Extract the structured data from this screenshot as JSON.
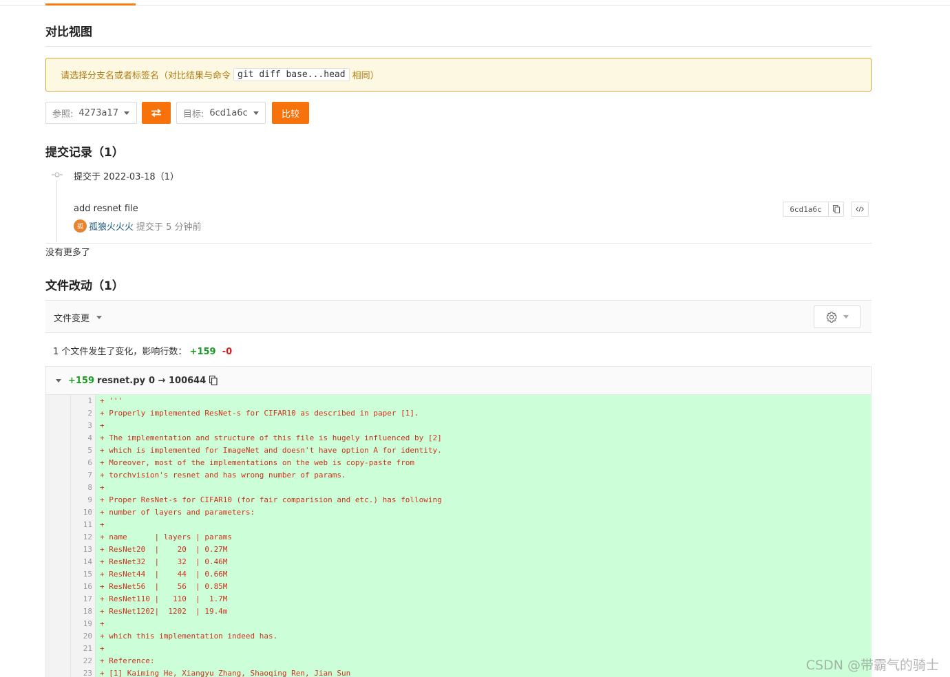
{
  "page": {
    "title": "对比视图"
  },
  "notice": {
    "text_before": "请选择分支名或者标签名（对比结果与命令",
    "command": "git diff base...head",
    "text_after": "相同）"
  },
  "compare": {
    "base_label": "参照:",
    "base_value": "4273a17",
    "swap_icon": "swap-arrows-icon",
    "target_label": "目标:",
    "target_value": "6cd1a6c",
    "compare_button": "比较"
  },
  "commits": {
    "heading": "提交记录（1）",
    "group_label": "提交于 2022-03-18（1）",
    "items": [
      {
        "message": "add resnet file",
        "avatar_char": "孤",
        "author": "孤狼火火火",
        "time_text": "提交于 5 分钟前",
        "sha": "6cd1a6c"
      }
    ],
    "no_more": "没有更多了"
  },
  "files": {
    "heading": "文件改动（1）",
    "filter_label": "文件变更",
    "summary_text": "1 个文件发生了变化，影响行数：",
    "additions": "+159",
    "deletions": "-0"
  },
  "diff": {
    "added": "+159",
    "filename": "resnet.py",
    "mode_change": "0 → 100644",
    "lines": [
      {
        "n": "1",
        "text": "+ '''"
      },
      {
        "n": "2",
        "text": "+ Properly implemented ResNet-s for CIFAR10 as described in paper [1]."
      },
      {
        "n": "3",
        "text": "+"
      },
      {
        "n": "4",
        "text": "+ The implementation and structure of this file is hugely influenced by [2]"
      },
      {
        "n": "5",
        "text": "+ which is implemented for ImageNet and doesn't have option A for identity."
      },
      {
        "n": "6",
        "text": "+ Moreover, most of the implementations on the web is copy-paste from"
      },
      {
        "n": "7",
        "text": "+ torchvision's resnet and has wrong number of params."
      },
      {
        "n": "8",
        "text": "+"
      },
      {
        "n": "9",
        "text": "+ Proper ResNet-s for CIFAR10 (for fair comparision and etc.) has following"
      },
      {
        "n": "10",
        "text": "+ number of layers and parameters:"
      },
      {
        "n": "11",
        "text": "+"
      },
      {
        "n": "12",
        "text": "+ name      | layers | params"
      },
      {
        "n": "13",
        "text": "+ ResNet20  |    20  | 0.27M"
      },
      {
        "n": "14",
        "text": "+ ResNet32  |    32  | 0.46M"
      },
      {
        "n": "15",
        "text": "+ ResNet44  |    44  | 0.66M"
      },
      {
        "n": "16",
        "text": "+ ResNet56  |    56  | 0.85M"
      },
      {
        "n": "17",
        "text": "+ ResNet110 |   110  |  1.7M"
      },
      {
        "n": "18",
        "text": "+ ResNet1202|  1202  | 19.4m"
      },
      {
        "n": "19",
        "text": "+"
      },
      {
        "n": "20",
        "text": "+ which this implementation indeed has."
      },
      {
        "n": "21",
        "text": "+"
      },
      {
        "n": "22",
        "text": "+ Reference:"
      },
      {
        "n": "23",
        "text": "+ [1] Kaiming He, Xiangyu Zhang, Shaoqing Ren, Jian Sun"
      }
    ]
  },
  "watermark": "CSDN @带霸气的骑士",
  "colors": {
    "accent": "#f8720c",
    "added_bg": "#ccffd8",
    "added_text": "#c8321e",
    "plus": "#1a9b24",
    "minus": "#d62020"
  }
}
